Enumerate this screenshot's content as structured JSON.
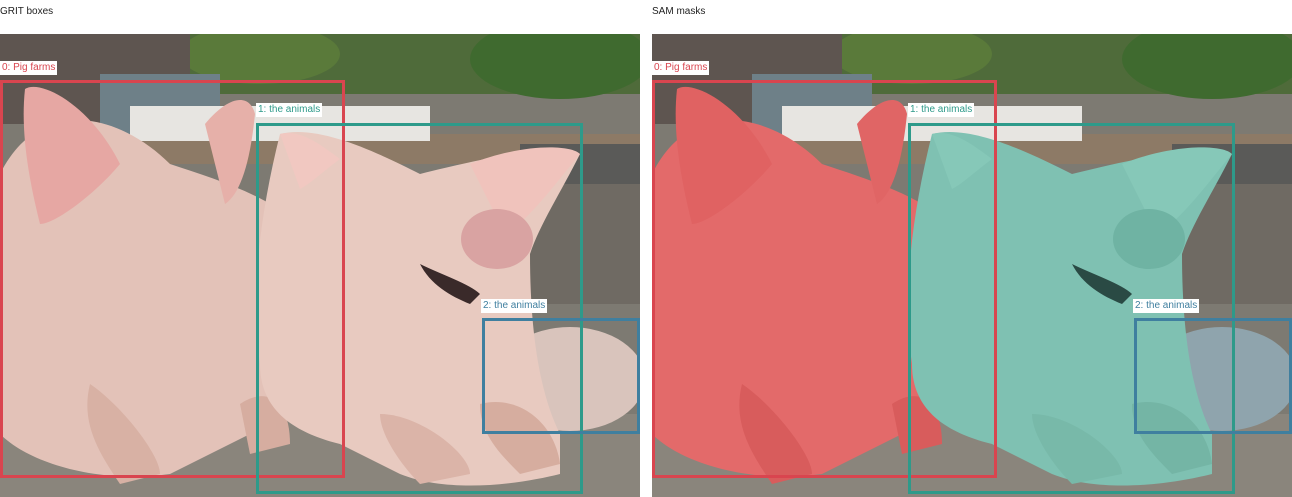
{
  "panels": [
    {
      "title": "GRIT boxes",
      "mode": "boxes",
      "detections": [
        {
          "label": "0: Pig farms",
          "color": "#d9454f"
        },
        {
          "label": "1: the animals",
          "color": "#2e9a8a"
        },
        {
          "label": "2: the animals",
          "color": "#3f7f9f"
        }
      ]
    },
    {
      "title": "SAM masks",
      "mode": "masks",
      "detections": [
        {
          "label": "0: Pig farms",
          "color": "#d9454f"
        },
        {
          "label": "1: the animals",
          "color": "#2e9a8a"
        },
        {
          "label": "2: the animals",
          "color": "#3f7f9f"
        }
      ]
    }
  ]
}
